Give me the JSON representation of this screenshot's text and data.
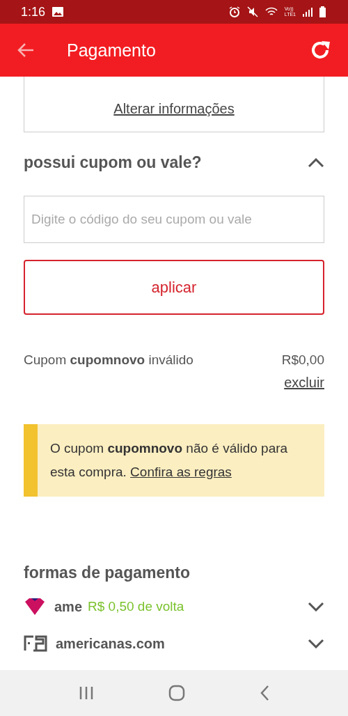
{
  "status_bar": {
    "time": "1:16",
    "network_top": "Vo))",
    "network_bottom": "LTE1"
  },
  "app_bar": {
    "title": "Pagamento"
  },
  "address_card": {
    "link": "Alterar informações"
  },
  "coupon": {
    "title": "possui cupom ou vale?",
    "expanded": true,
    "placeholder": "Digite o código do seu cupom ou vale",
    "button": "aplicar",
    "result": {
      "text": "Cupom **cupomnovo** inválido",
      "amount": "R$0,00",
      "remove": "excluir"
    },
    "notice": {
      "text": "O cupom **cupomnovo** não é válido para esta compra.",
      "link": "Confira as regras"
    }
  },
  "payment": {
    "title": "formas de pagamento",
    "methods": [
      {
        "kind": "ame",
        "name": "ame",
        "cashback": "R$ 0,50 de volta",
        "expanded": false
      },
      {
        "kind": "americanas",
        "name": "americanas.com",
        "expanded": false
      }
    ]
  }
}
